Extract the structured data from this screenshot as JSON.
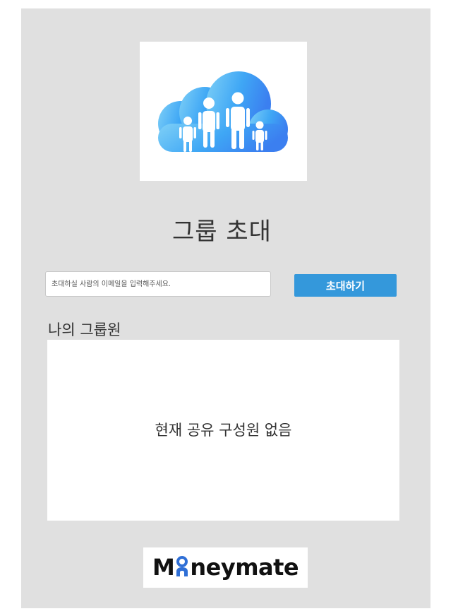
{
  "header": {
    "title": "그룹 초대"
  },
  "invite": {
    "email_placeholder": "초대하실 사람의 이메일을 입력해주세요.",
    "email_value": "",
    "button_label": "초대하기"
  },
  "members": {
    "section_label": "나의 그룹원",
    "empty_message": "현재 공유 구성원 없음"
  },
  "logo": {
    "text": "Moneymate"
  },
  "icons": {
    "hero": "family-sharing-cloud-icon"
  },
  "colors": {
    "panel_background": "#e0e0e0",
    "accent": "#3498db",
    "logo_blue": "#2f6fd6"
  }
}
